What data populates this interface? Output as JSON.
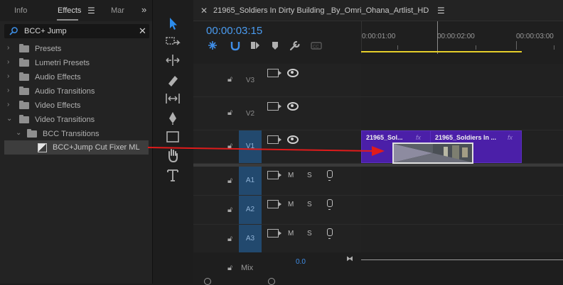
{
  "effects_panel": {
    "tabs": [
      "Info",
      "Effects",
      "Mar"
    ],
    "active_tab": "Effects",
    "search_value": "BCC+ Jump",
    "tree": [
      {
        "label": "Presets",
        "expanded": false
      },
      {
        "label": "Lumetri Presets",
        "expanded": false
      },
      {
        "label": "Audio Effects",
        "expanded": false
      },
      {
        "label": "Audio Transitions",
        "expanded": false
      },
      {
        "label": "Video Effects",
        "expanded": false
      },
      {
        "label": "Video Transitions",
        "expanded": true
      },
      {
        "label": "BCC Transitions",
        "expanded": true
      },
      {
        "label": "BCC+Jump Cut Fixer ML",
        "selected": true
      }
    ]
  },
  "timeline": {
    "sequence_title": "21965_Soldiers In Dirty Building _By_Omri_Ohana_Artlist_HD",
    "timecode": "00:00:03:15",
    "ruler_labels": [
      "0:00:01:00",
      "00:00:02:00",
      "00:00:03:00"
    ],
    "video_tracks": [
      "V3",
      "V2",
      "V1"
    ],
    "audio_tracks": [
      "A1",
      "A2",
      "A3"
    ],
    "audio_buttons": {
      "mute": "M",
      "solo": "S"
    },
    "mix_label": "Mix",
    "mix_value": "0.0",
    "clips": [
      {
        "label": "21965_Sol...",
        "fx": "fx"
      },
      {
        "label": "21965_Soldiers In ...",
        "fx": "fx"
      }
    ]
  },
  "colors": {
    "accent_blue": "#2d8ceb",
    "timecode": "#4a9bf0",
    "clip_purple": "#4b1fa8",
    "work_area": "#e6cf2a",
    "arrow_red": "#e01b1b"
  }
}
